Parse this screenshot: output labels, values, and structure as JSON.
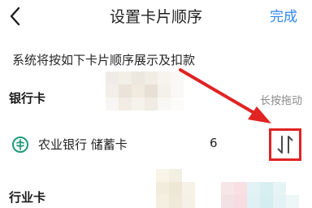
{
  "header": {
    "title": "设置卡片顺序",
    "done_label": "完成",
    "back_icon": "chevron-left-icon"
  },
  "instruction": "系统将按如下卡片顺序展示及扣款",
  "bank_section": {
    "label": "银行卡",
    "hint": "长按拖动",
    "cards": [
      {
        "name": "农业银行 储蓄卡",
        "tail": "6",
        "logo_icon": "agricultural-bank-logo",
        "handle_icon": "drag-sort-icon"
      }
    ]
  },
  "industry_section": {
    "label": "行业卡"
  },
  "colors": {
    "accent": "#2f86f0",
    "annotation": "#e02323",
    "bank_logo": "#1f9a7a"
  }
}
